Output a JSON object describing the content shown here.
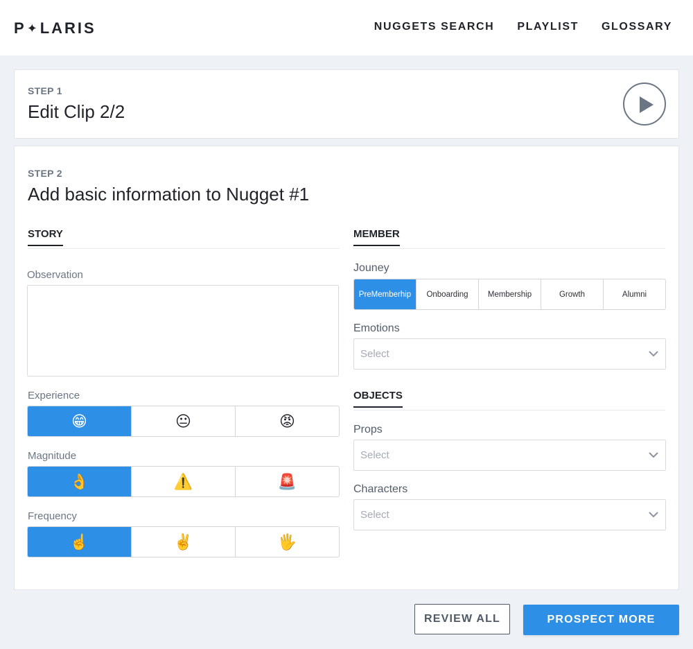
{
  "brand": {
    "logo_left": "P",
    "logo_star": "✦",
    "logo_right": "LARIS"
  },
  "nav": [
    {
      "label": "NUGGETS SEARCH"
    },
    {
      "label": "PLAYLIST"
    },
    {
      "label": "GLOSSARY"
    }
  ],
  "step1": {
    "label": "STEP 1",
    "title": "Edit Clip 2/2"
  },
  "step2": {
    "label": "STEP 2",
    "title": "Add basic information to Nugget #1"
  },
  "story": {
    "heading": "STORY",
    "observation": {
      "label": "Observation",
      "value": ""
    },
    "experience": {
      "label": "Experience",
      "options": [
        "😁",
        "😐",
        "😡"
      ],
      "selected_index": 0
    },
    "magnitude": {
      "label": "Magnitude",
      "options": [
        "👌",
        "⚠️",
        "🚨"
      ],
      "selected_index": 0
    },
    "frequency": {
      "label": "Frequency",
      "options": [
        "☝️",
        "✌️",
        "🖐️"
      ],
      "selected_index": 0
    }
  },
  "member": {
    "heading": "MEMBER",
    "journey": {
      "label": "Jouney",
      "options": [
        "PreMemberhip",
        "Onboarding",
        "Membership",
        "Growth",
        "Alumni"
      ],
      "selected_index": 0
    },
    "emotions": {
      "label": "Emotions",
      "placeholder": "Select"
    }
  },
  "objects": {
    "heading": "OBJECTS",
    "props": {
      "label": "Props",
      "placeholder": "Select"
    },
    "characters": {
      "label": "Characters",
      "placeholder": "Select"
    }
  },
  "actions": {
    "review_all": "REVIEW ALL",
    "prospect_more": "PROSPECT MORE"
  },
  "colors": {
    "accent": "#2d8fe6",
    "text": "#1f2329",
    "muted": "#6b7685",
    "background": "#eef1f5"
  }
}
